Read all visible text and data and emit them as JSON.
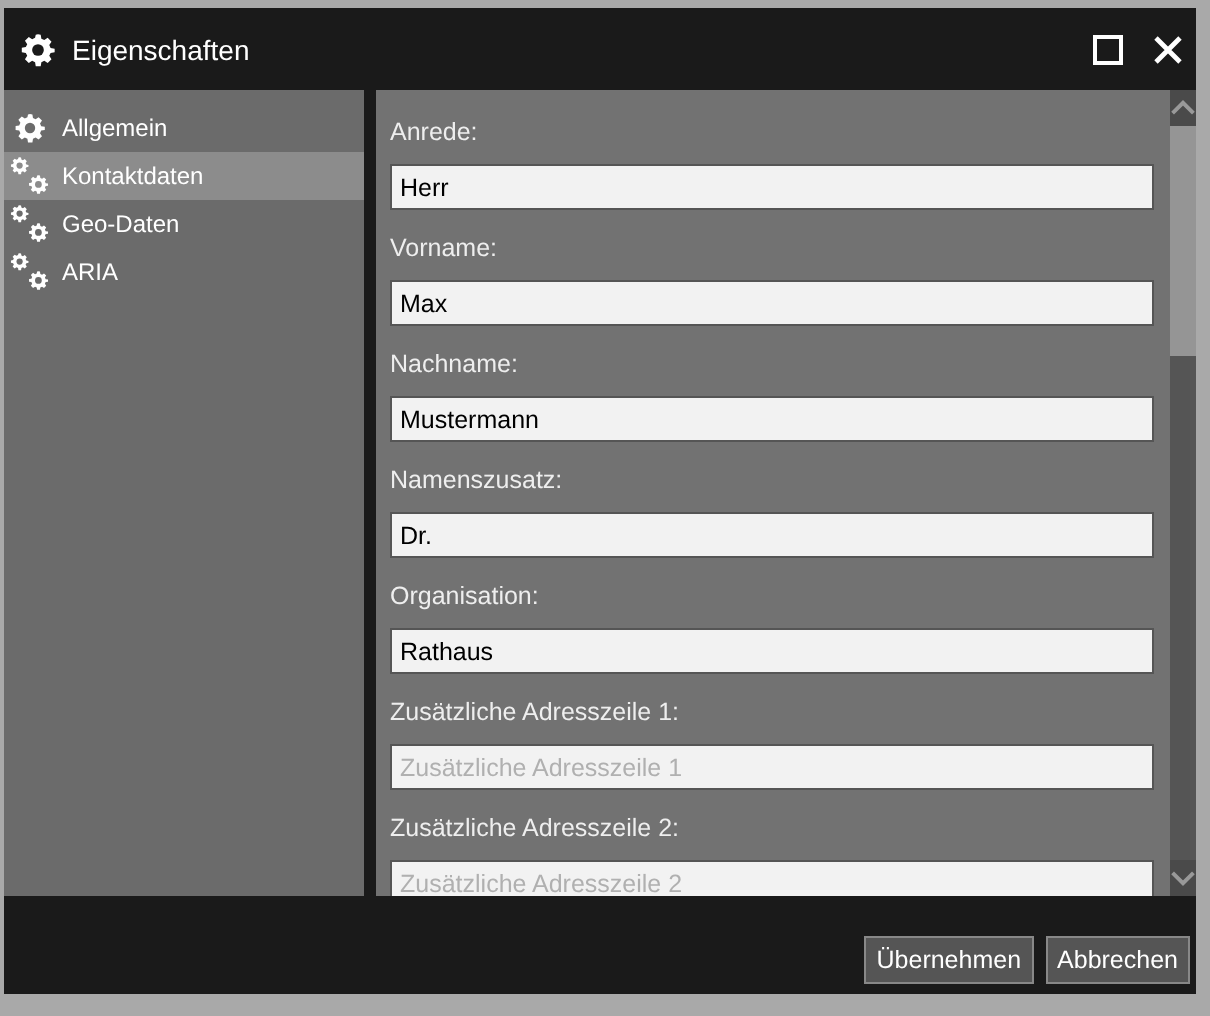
{
  "window": {
    "title": "Eigenschaften"
  },
  "sidebar": {
    "items": [
      {
        "label": "Allgemein",
        "kind": "gear",
        "selected": false
      },
      {
        "label": "Kontaktdaten",
        "kind": "gears",
        "selected": true
      },
      {
        "label": "Geo-Daten",
        "kind": "gears",
        "selected": false
      },
      {
        "label": "ARIA",
        "kind": "gears",
        "selected": false
      }
    ]
  },
  "fields": [
    {
      "label": "Anrede:",
      "value": "Herr"
    },
    {
      "label": "Vorname:",
      "value": "Max"
    },
    {
      "label": "Nachname:",
      "value": "Mustermann"
    },
    {
      "label": "Namenszusatz:",
      "value": "Dr."
    },
    {
      "label": "Organisation:",
      "value": "Rathaus"
    },
    {
      "label": "Zusätzliche Adresszeile 1:",
      "placeholder": "Zusätzliche Adresszeile 1"
    },
    {
      "label": "Zusätzliche Adresszeile 2:",
      "placeholder": "Zusätzliche Adresszeile 2"
    }
  ],
  "buttons": [
    "Übernehmen",
    "Abbrechen"
  ]
}
